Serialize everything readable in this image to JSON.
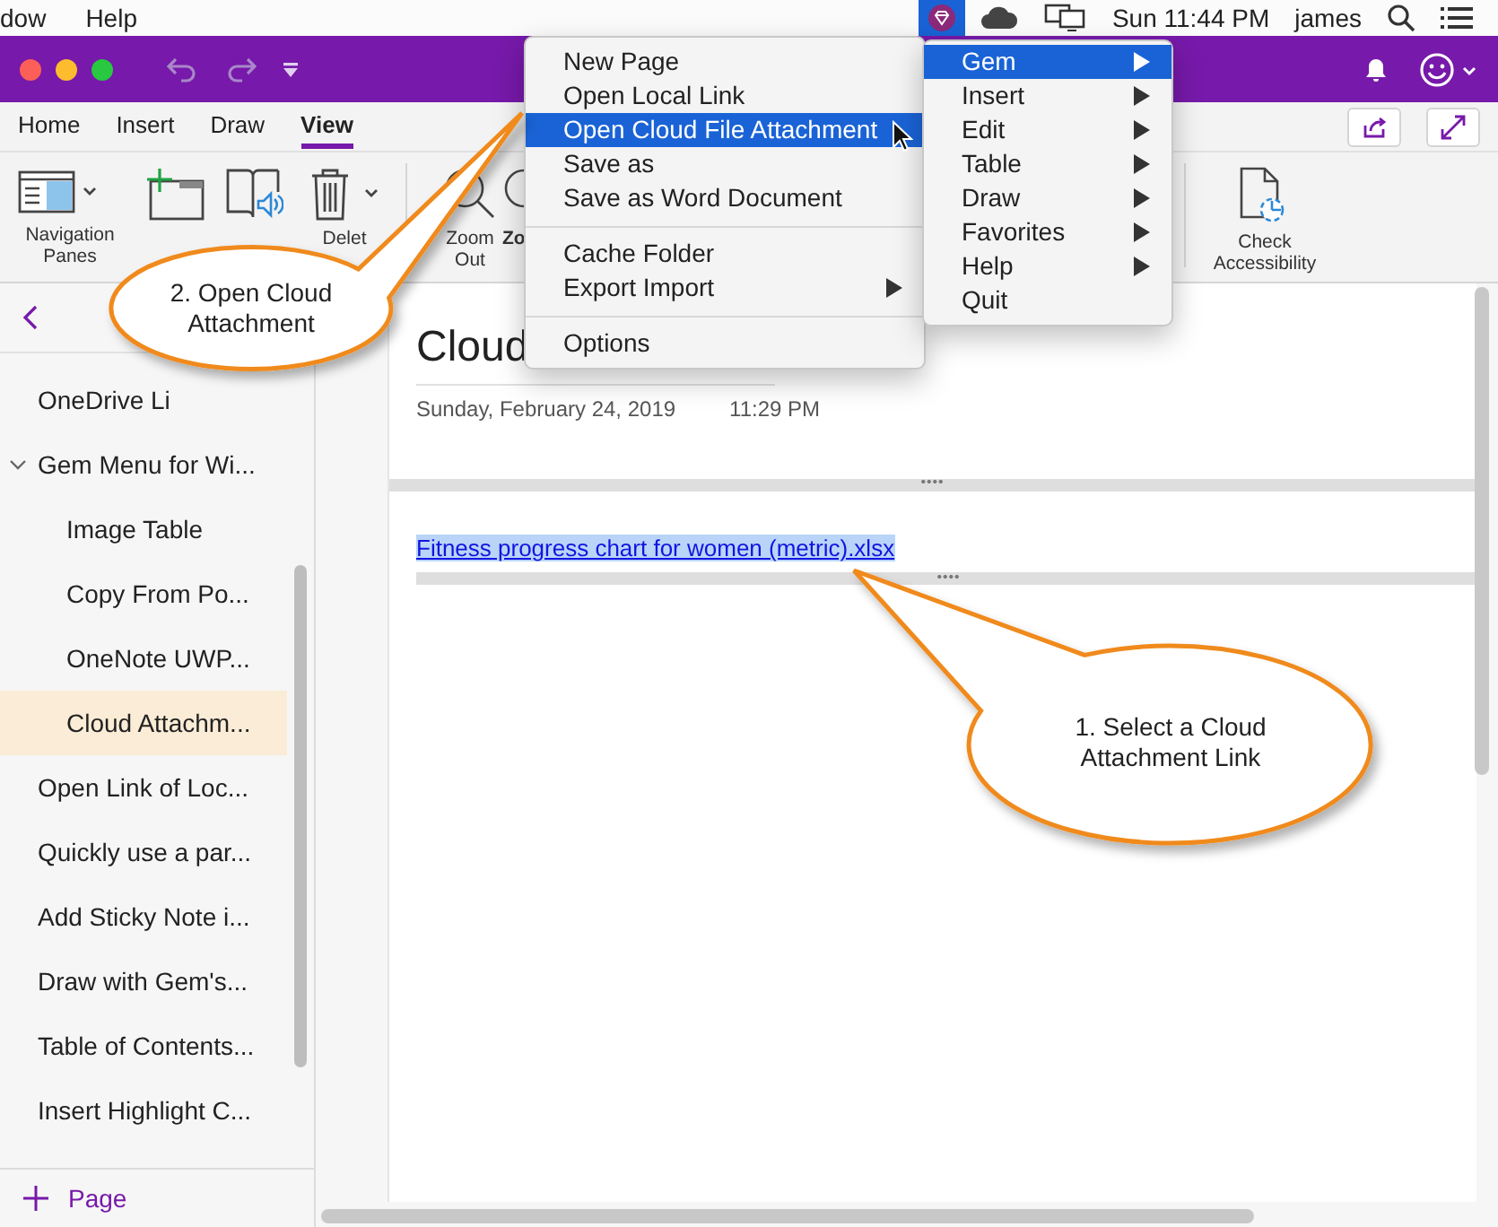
{
  "menubar": {
    "items": [
      "dow",
      "Help"
    ],
    "gem_selected": true,
    "clock": "Sun 11:44 PM",
    "user": "james"
  },
  "ribbon_tabs": [
    {
      "label": "Home",
      "selected": false
    },
    {
      "label": "Insert",
      "selected": false
    },
    {
      "label": "Draw",
      "selected": false
    },
    {
      "label": "View",
      "selected": true
    }
  ],
  "toolbar": [
    {
      "kind": "panes",
      "label": "Navigation Panes"
    },
    {
      "kind": "section"
    },
    {
      "kind": "reader"
    },
    {
      "kind": "trash",
      "label": "Delet"
    },
    {
      "kind": "zoom-out",
      "label": "Zoom Out"
    },
    {
      "kind": "zoom-in",
      "label": "Zo"
    },
    {
      "kind": "accessibility",
      "label": "Check Accessibility"
    }
  ],
  "sidebar": {
    "pages": [
      {
        "label": "OneDrive Li",
        "selected": false
      },
      {
        "label": "Gem Menu for Wi...",
        "selected": false,
        "expanded": true,
        "children": [
          {
            "label": "Image Table",
            "selected": false
          },
          {
            "label": "Copy From Po...",
            "selected": false
          },
          {
            "label": "OneNote UWP...",
            "selected": false
          },
          {
            "label": "Cloud Attachm...",
            "selected": true
          }
        ]
      },
      {
        "label": "Open Link of Loc...",
        "selected": false
      },
      {
        "label": "Quickly use a par...",
        "selected": false
      },
      {
        "label": "Add Sticky Note i...",
        "selected": false
      },
      {
        "label": "Draw with Gem's...",
        "selected": false
      },
      {
        "label": "Table of Contents...",
        "selected": false
      },
      {
        "label": "Insert Highlight C...",
        "selected": false
      }
    ],
    "add_page": "Page"
  },
  "page": {
    "title": "Cloud",
    "date": "Sunday, February 24, 2019",
    "time": "11:29 PM",
    "link": "Fitness progress chart for women (metric).xlsx",
    "link_selected": true
  },
  "file_menu": {
    "groups": [
      [
        {
          "label": "New Page",
          "selected": false,
          "submenu": false
        },
        {
          "label": "Open Local Link",
          "selected": false,
          "submenu": false
        },
        {
          "label": "Open Cloud File Attachment",
          "selected": true,
          "submenu": false
        },
        {
          "label": "Save as",
          "selected": false,
          "submenu": false
        },
        {
          "label": "Save as Word Document",
          "selected": false,
          "submenu": false
        }
      ],
      [
        {
          "label": "Cache Folder",
          "selected": false,
          "submenu": false
        },
        {
          "label": "Export Import",
          "selected": false,
          "submenu": true
        }
      ],
      [
        {
          "label": "Options",
          "selected": false,
          "submenu": false
        }
      ]
    ]
  },
  "gem_menu": {
    "items": [
      {
        "label": "Gem",
        "selected": true,
        "submenu": true
      },
      {
        "label": "Insert",
        "selected": false,
        "submenu": true
      },
      {
        "label": "Edit",
        "selected": false,
        "submenu": true
      },
      {
        "label": "Table",
        "selected": false,
        "submenu": true
      },
      {
        "label": "Draw",
        "selected": false,
        "submenu": true
      },
      {
        "label": "Favorites",
        "selected": false,
        "submenu": true
      },
      {
        "label": "Help",
        "selected": false,
        "submenu": true
      },
      {
        "label": "Quit",
        "selected": false,
        "submenu": false
      }
    ]
  },
  "callouts": [
    {
      "text": "2. Open Cloud Attachment"
    },
    {
      "text": "1. Select a Cloud Attachment Link"
    }
  ]
}
